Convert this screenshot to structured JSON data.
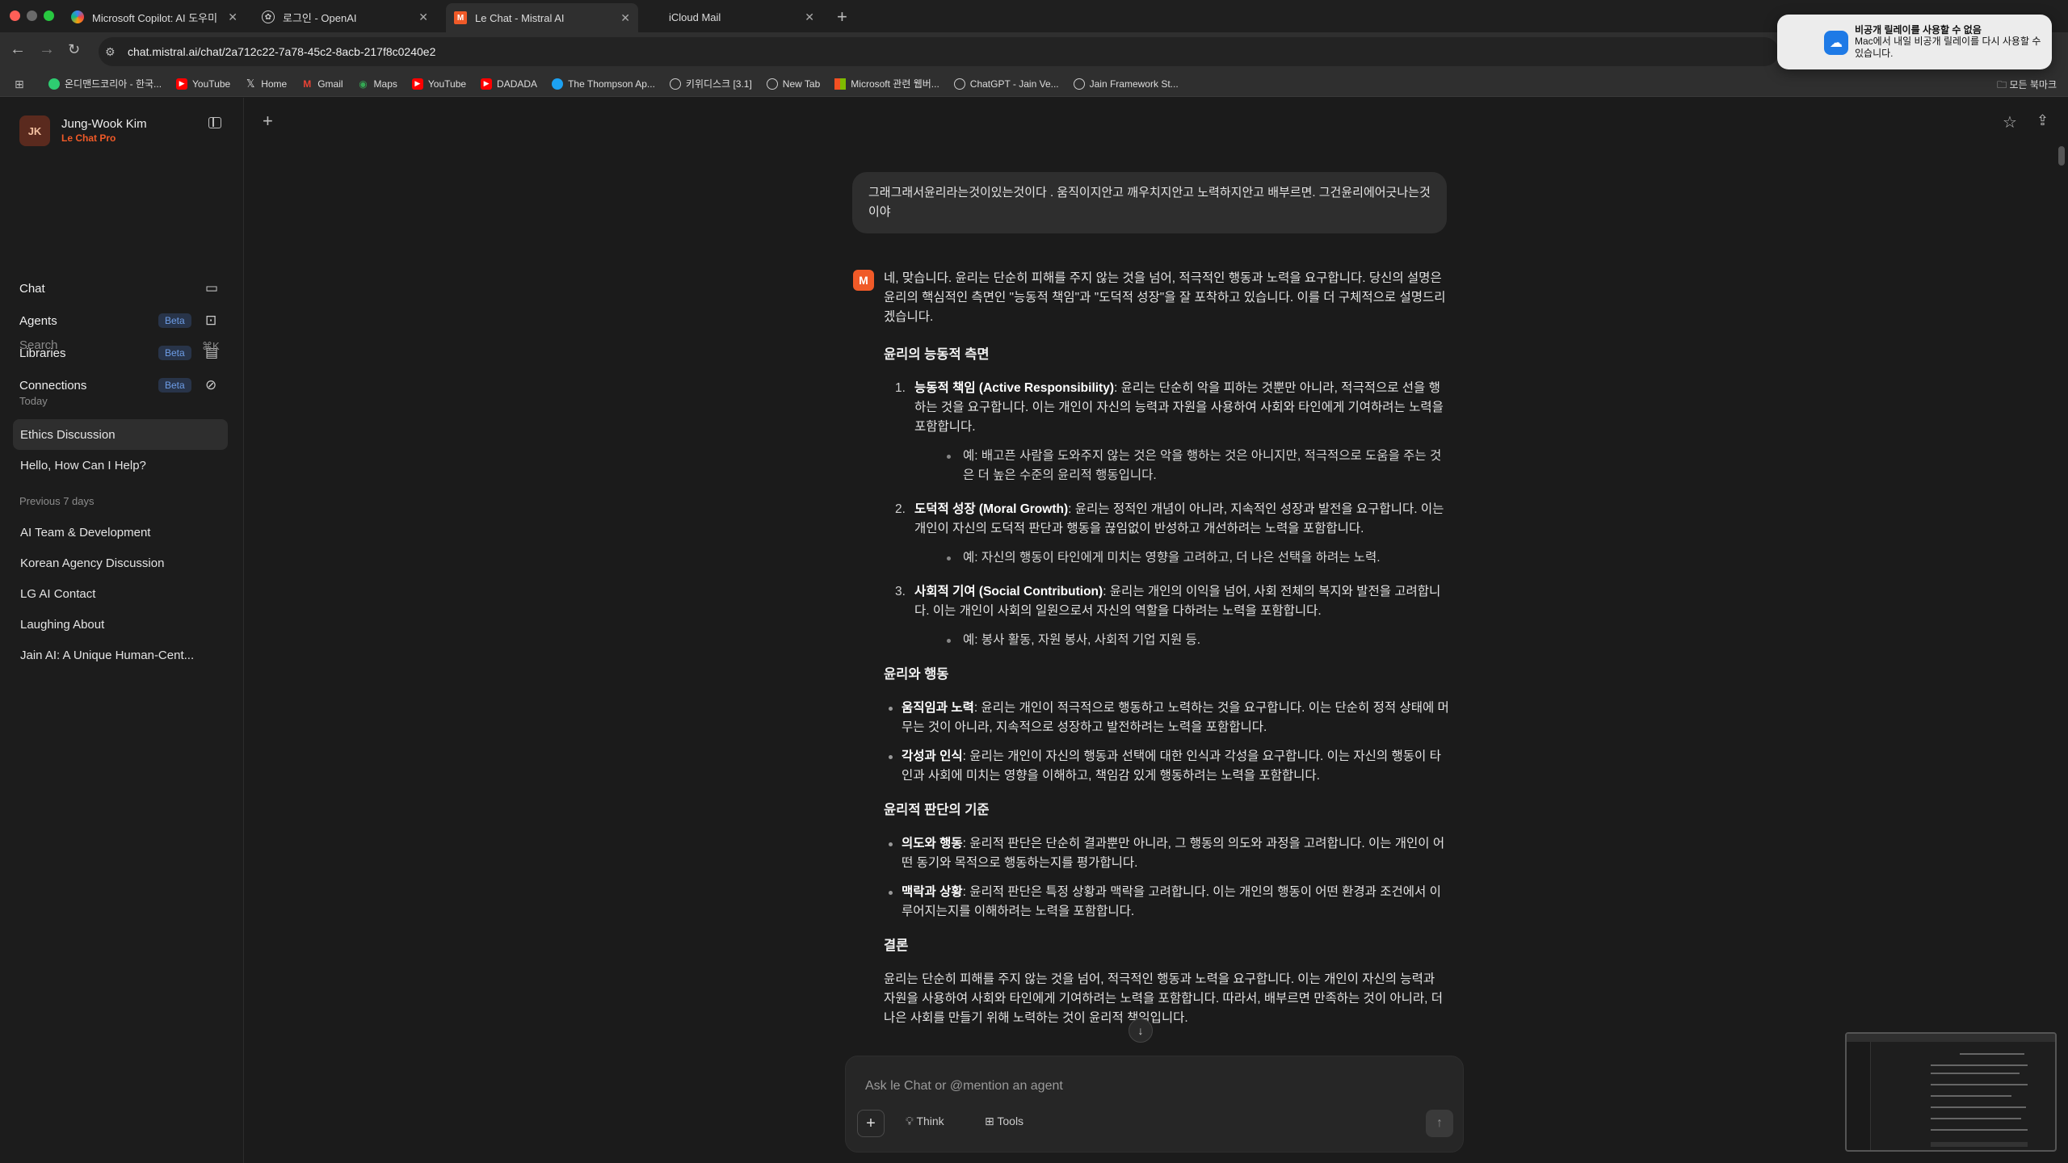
{
  "browser": {
    "tabs": [
      {
        "label": "Microsoft Copilot: AI 도우미",
        "icon": "copilot-icon"
      },
      {
        "label": "로그인 - OpenAI",
        "icon": "openai-icon"
      },
      {
        "label": "Le Chat - Mistral AI",
        "icon": "mistral-icon"
      },
      {
        "label": "iCloud Mail",
        "icon": "apple-icon"
      }
    ],
    "url": "chat.mistral.ai/chat/2a712c22-7a78-45c2-8acb-217f8c0240e2",
    "bookmarks": [
      "온디맨드코리아 - 한국...",
      "YouTube",
      "Home",
      "Gmail",
      "Maps",
      "YouTube",
      "DADADA",
      "The Thompson Ap...",
      "키위디스크 [3.1]",
      "New Tab",
      "Microsoft 관련 웹버...",
      "ChatGPT - Jain Ve...",
      "Jain Framework St..."
    ],
    "all_bookmarks": "모든 북마크"
  },
  "notification": {
    "title": "비공개 릴레이를 사용할 수 없음",
    "body": "Mac에서 내일 비공개 릴레이를 다시 사용할 수 있습니다."
  },
  "sidebar": {
    "user_initials": "JK",
    "user_name": "Jung-Wook Kim",
    "plan": "Le Chat Pro",
    "nav": [
      {
        "label": "Chat",
        "badge": ""
      },
      {
        "label": "Agents",
        "badge": "Beta"
      },
      {
        "label": "Libraries",
        "badge": "Beta"
      },
      {
        "label": "Connections",
        "badge": "Beta"
      }
    ],
    "search_label": "Search",
    "search_shortcut": "⌘K",
    "today_label": "Today",
    "today_items": [
      "Ethics Discussion",
      "Hello, How Can I Help?"
    ],
    "prev_label": "Previous 7 days",
    "prev_items": [
      "AI Team & Development",
      "Korean Agency Discussion",
      "LG AI Contact",
      "Laughing About",
      "Jain AI: A Unique Human-Cent..."
    ]
  },
  "conversation": {
    "user_message": "그래그래서윤리라는것이있는것이다 . 움직이지안고 깨우치지안고 노력하지안고 배부르면. 그건윤리에어긋나는것이야",
    "intro": "네, 맞습니다. 윤리는 단순히 피해를 주지 않는 것을 넘어, 적극적인 행동과 노력을 요구합니다. 당신의 설명은 윤리의 핵심적인 측면인 \"능동적 책임\"과 \"도덕적 성장\"을 잘 포착하고 있습니다. 이를 더 구체적으로 설명드리겠습니다.",
    "section1_title": "윤리의 능동적 측면",
    "section1_items": [
      {
        "num": "1.",
        "bold": "능동적 책임 (Active Responsibility)",
        "text": ": 윤리는 단순히 악을 피하는 것뿐만 아니라, 적극적으로 선을 행하는 것을 요구합니다. 이는 개인이 자신의 능력과 자원을 사용하여 사회와 타인에게 기여하려는 노력을 포함합니다.",
        "example": "예: 배고픈 사람을 도와주지 않는 것은 악을 행하는 것은 아니지만, 적극적으로 도움을 주는 것은 더 높은 수준의 윤리적 행동입니다."
      },
      {
        "num": "2.",
        "bold": "도덕적 성장 (Moral Growth)",
        "text": ": 윤리는 정적인 개념이 아니라, 지속적인 성장과 발전을 요구합니다. 이는 개인이 자신의 도덕적 판단과 행동을 끊임없이 반성하고 개선하려는 노력을 포함합니다.",
        "example": "예: 자신의 행동이 타인에게 미치는 영향을 고려하고, 더 나은 선택을 하려는 노력."
      },
      {
        "num": "3.",
        "bold": "사회적 기여 (Social Contribution)",
        "text": ": 윤리는 개인의 이익을 넘어, 사회 전체의 복지와 발전을 고려합니다. 이는 개인이 사회의 일원으로서 자신의 역할을 다하려는 노력을 포함합니다.",
        "example": "예: 봉사 활동, 자원 봉사, 사회적 기업 지원 등."
      }
    ],
    "section2_title": "윤리와 행동",
    "section2_items": [
      {
        "bold": "움직임과 노력",
        "text": ": 윤리는 개인이 적극적으로 행동하고 노력하는 것을 요구합니다. 이는 단순히 정적 상태에 머무는 것이 아니라, 지속적으로 성장하고 발전하려는 노력을 포함합니다."
      },
      {
        "bold": "각성과 인식",
        "text": ": 윤리는 개인이 자신의 행동과 선택에 대한 인식과 각성을 요구합니다. 이는 자신의 행동이 타인과 사회에 미치는 영향을 이해하고, 책임감 있게 행동하려는 노력을 포함합니다."
      }
    ],
    "section3_title": "윤리적 판단의 기준",
    "section3_items": [
      {
        "bold": "의도와 행동",
        "text": ": 윤리적 판단은 단순히 결과뿐만 아니라, 그 행동의 의도와 과정을 고려합니다. 이는 개인이 어떤 동기와 목적으로 행동하는지를 평가합니다."
      },
      {
        "bold": "맥락과 상황",
        "text": ": 윤리적 판단은 특정 상황과 맥락을 고려합니다. 이는 개인의 행동이 어떤 환경과 조건에서 이루어지는지를 이해하려는 노력을 포함합니다."
      }
    ],
    "conclusion_title": "결론",
    "conclusion": "윤리는 단순히 피해를 주지 않는 것을 넘어, 적극적인 행동과 노력을 요구합니다. 이는 개인이 자신의 능력과 자원을 사용하여 사회와 타인에게 기여하려는 노력을 포함합니다. 따라서, 배부르면 만족하는 것이 아니라, 더 나은 사회를 만들기 위해 노력하는 것이 윤리적 책임입니다."
  },
  "composer": {
    "placeholder": "Ask le Chat or @mention an agent",
    "think_label": "Think",
    "tools_label": "Tools"
  }
}
